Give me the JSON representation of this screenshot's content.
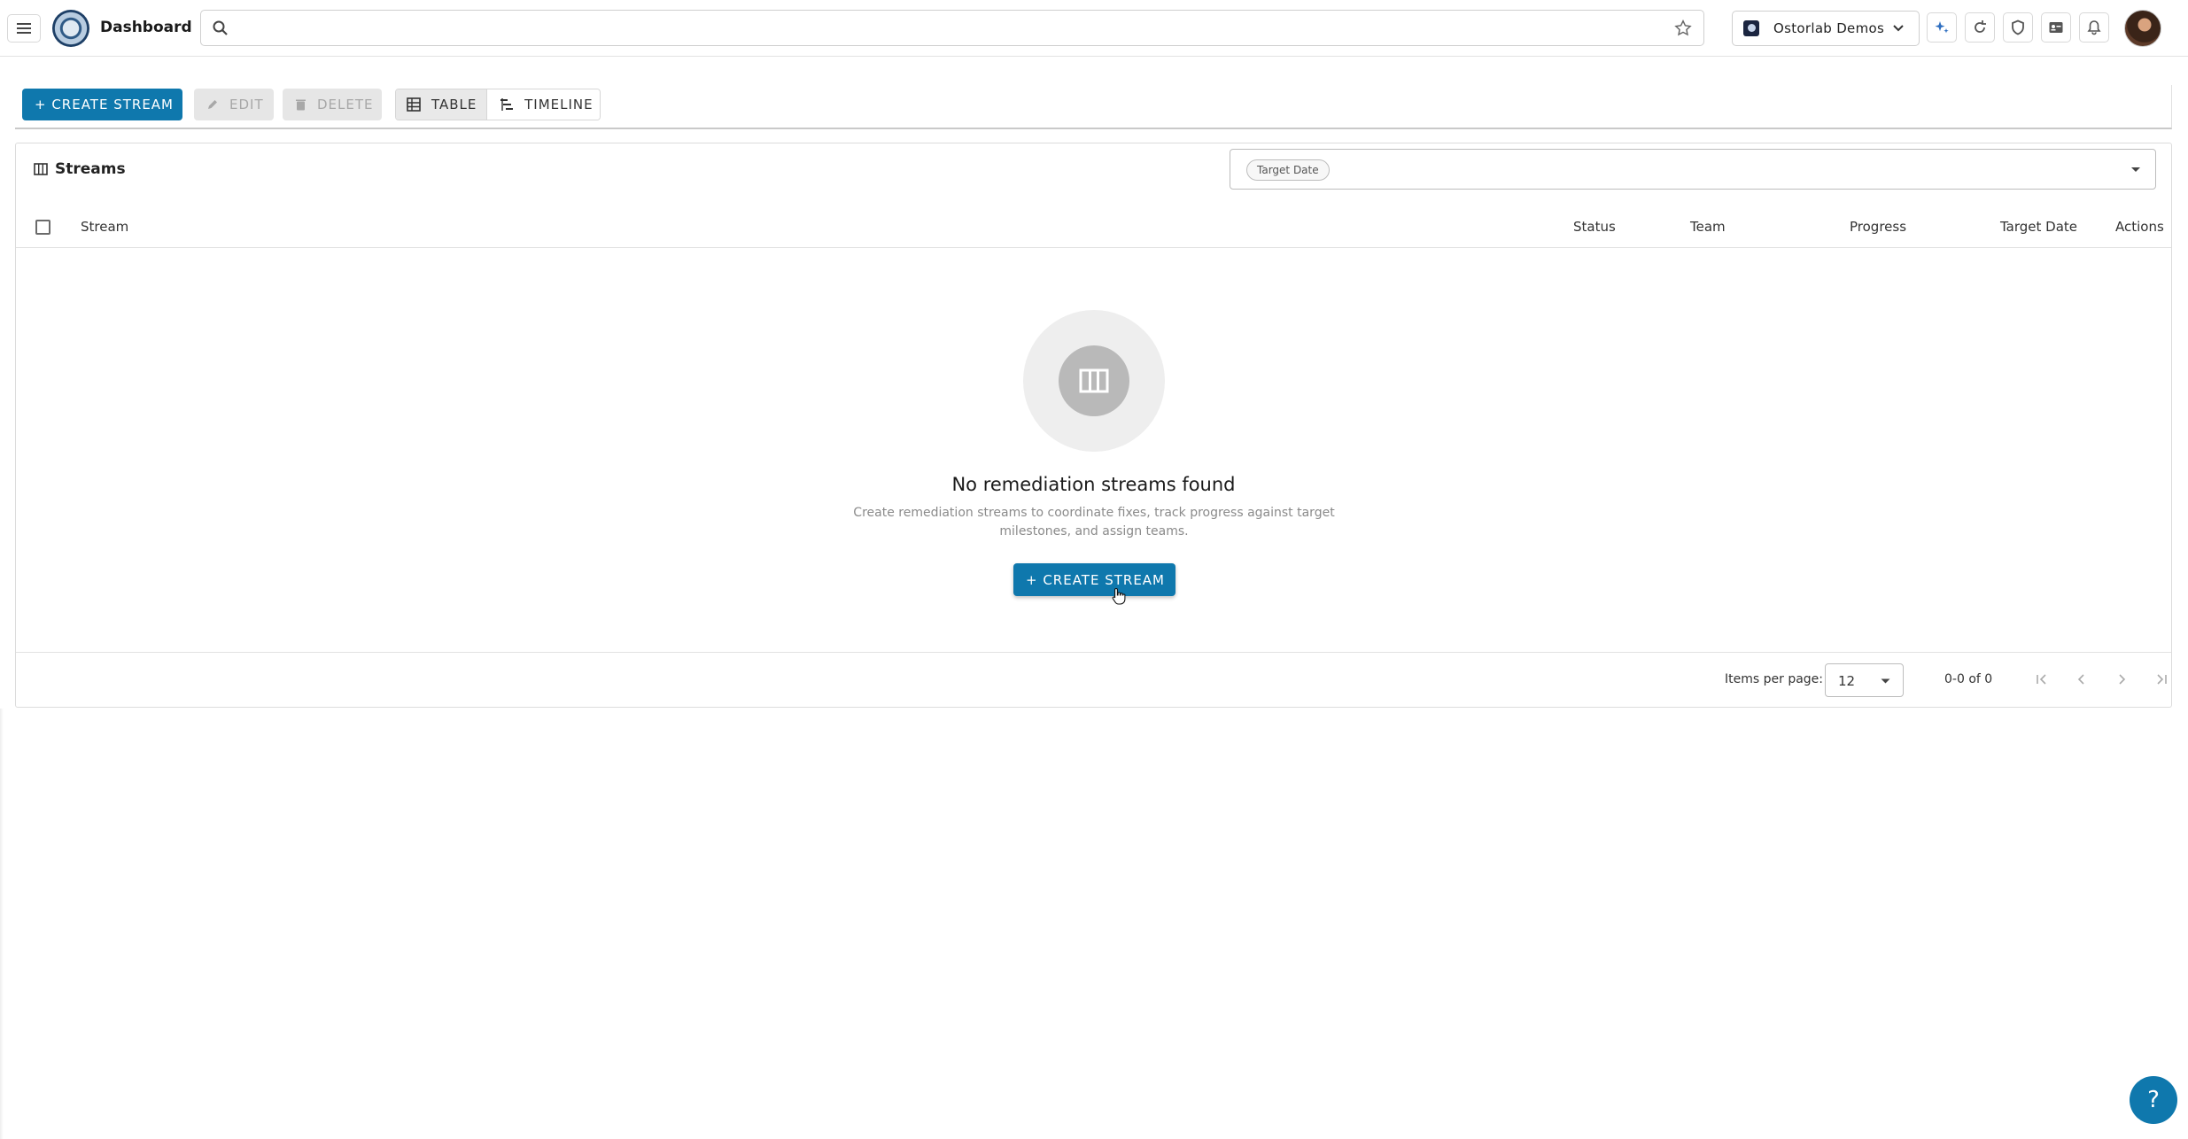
{
  "header": {
    "title": "Dashboard",
    "search_placeholder": "",
    "org_name": "Ostorlab Demos"
  },
  "toolbar": {
    "create_label": "+ CREATE STREAM",
    "edit_label": "EDIT",
    "delete_label": "DELETE",
    "table_label": "TABLE",
    "timeline_label": "TIMELINE"
  },
  "card": {
    "title": "Streams",
    "filter_chip": "Target Date",
    "columns": [
      "Stream",
      "Status",
      "Team",
      "Progress",
      "Target Date",
      "Actions"
    ]
  },
  "empty_state": {
    "title": "No remediation streams found",
    "description": "Create remediation streams to coordinate fixes, track progress against target milestones, and assign teams.",
    "button_label": "+ CREATE STREAM"
  },
  "paginator": {
    "items_per_page_label": "Items per page:",
    "items_per_page_value": "12",
    "range_label": "0-0 of 0"
  },
  "help": {
    "label": "?"
  },
  "colors": {
    "primary": "#0f78ad",
    "disabled_bg": "#e6e6e6",
    "disabled_text": "#a8a8a8"
  }
}
